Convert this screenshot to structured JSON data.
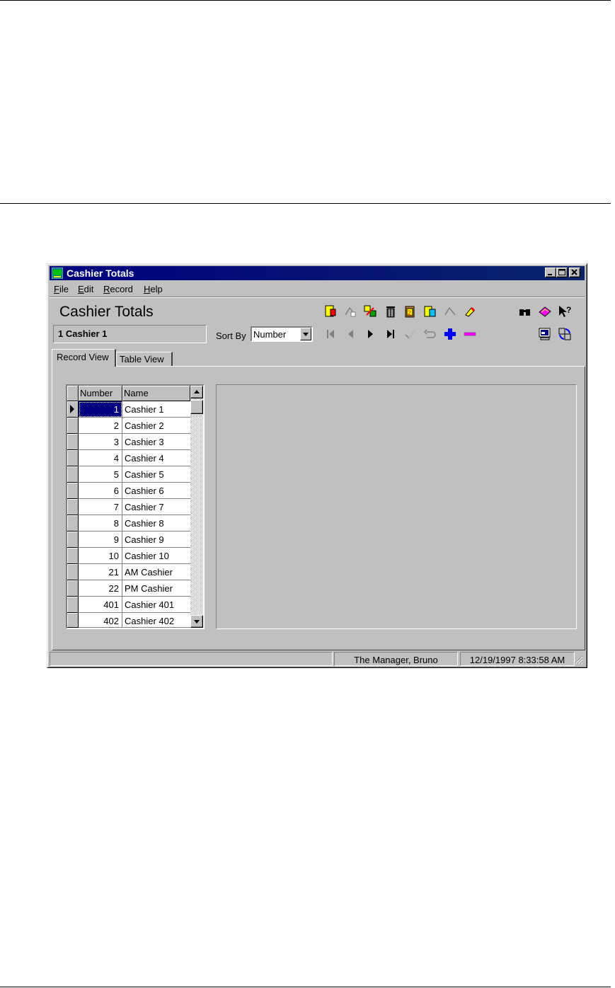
{
  "window": {
    "title": "Cashier Totals",
    "controls": [
      "minimize",
      "maximize",
      "close"
    ]
  },
  "menu": {
    "items": [
      {
        "label": "File",
        "mnemonic": "F",
        "rest": "ile"
      },
      {
        "label": "Edit",
        "mnemonic": "E",
        "rest": "dit"
      },
      {
        "label": "Record",
        "mnemonic": "R",
        "rest": "ecord"
      },
      {
        "label": "Help",
        "mnemonic": "H",
        "rest": "elp"
      }
    ]
  },
  "header": {
    "form_title": "Cashier Totals",
    "current_record": "1 Cashier 1",
    "sort_by_label": "Sort By",
    "sort_by_value": "Number"
  },
  "toolbar": {
    "row1_icons": [
      "new-record-icon",
      "copy-record-icon",
      "link-record-icon",
      "trash-icon",
      "clipboard-copy-icon",
      "paste-record-icon",
      "clear-icon",
      "eraser-icon"
    ],
    "row1_right_icons": [
      "binoculars-icon",
      "book-icon",
      "help-pointer-icon"
    ],
    "row2_icons": [
      "first-record-icon",
      "previous-record-icon",
      "next-record-icon",
      "last-record-icon",
      "confirm-icon",
      "undo-icon",
      "add-record-icon",
      "delete-record-icon"
    ],
    "row2_right_icons": [
      "screen-icon",
      "refresh-icon"
    ]
  },
  "tabs": [
    {
      "label": "Record View",
      "active": true
    },
    {
      "label": "Table View",
      "active": false
    }
  ],
  "grid": {
    "columns": [
      "Number",
      "Name"
    ],
    "rows": [
      {
        "number": "1",
        "name": "Cashier 1"
      },
      {
        "number": "2",
        "name": "Cashier 2"
      },
      {
        "number": "3",
        "name": "Cashier 3"
      },
      {
        "number": "4",
        "name": "Cashier 4"
      },
      {
        "number": "5",
        "name": "Cashier 5"
      },
      {
        "number": "6",
        "name": "Cashier 6"
      },
      {
        "number": "7",
        "name": "Cashier 7"
      },
      {
        "number": "8",
        "name": "Cashier 8"
      },
      {
        "number": "9",
        "name": "Cashier 9"
      },
      {
        "number": "10",
        "name": "Cashier 10"
      },
      {
        "number": "21",
        "name": "AM Cashier"
      },
      {
        "number": "22",
        "name": "PM Cashier"
      },
      {
        "number": "401",
        "name": "Cashier 401"
      },
      {
        "number": "402",
        "name": "Cashier 402"
      }
    ]
  },
  "status": {
    "pane1": "",
    "user": "The Manager, Bruno",
    "datetime": "12/19/1997 8:33:58 AM"
  },
  "colors": {
    "titlebar": "#000080",
    "face": "#c0c0c0",
    "add": "#0000ff",
    "delete": "#ff00ff"
  }
}
